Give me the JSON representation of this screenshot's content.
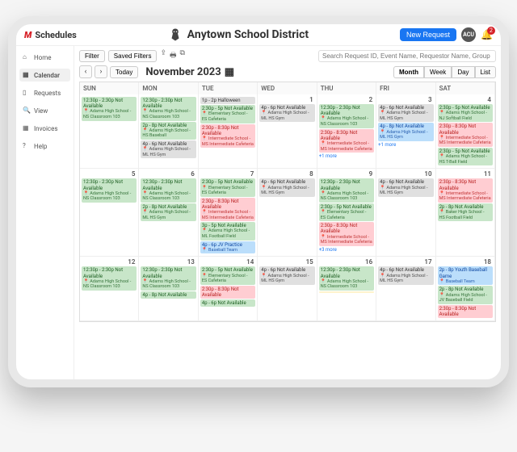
{
  "brand": {
    "prefix": "M",
    "name": "Schedules"
  },
  "district": "Anytown School District",
  "header_actions": {
    "new_request": "New Request",
    "avatar": "ACU",
    "notif_count": "2"
  },
  "sidebar": {
    "items": [
      {
        "icon": "home",
        "label": "Home"
      },
      {
        "icon": "calendar",
        "label": "Calendar"
      },
      {
        "icon": "doc",
        "label": "Requests"
      },
      {
        "icon": "view",
        "label": "View"
      },
      {
        "icon": "invoice",
        "label": "Invoices"
      },
      {
        "icon": "help",
        "label": "Help"
      }
    ]
  },
  "toolbar": {
    "filter": "Filter",
    "saved": "Saved Filters"
  },
  "search_placeholder": "Search Request ID, Event Name, Requestor Name, Group Name, Schedule ID",
  "nav": {
    "today": "Today",
    "month_label": "November 2023"
  },
  "views": [
    "Month",
    "Week",
    "Day",
    "List"
  ],
  "active_view": "Month",
  "day_headers": [
    "SUN",
    "MON",
    "TUE",
    "WED",
    "THU",
    "FRI",
    "SAT"
  ],
  "weeks": [
    [
      {
        "num": "",
        "events": [
          {
            "c": "green",
            "t": "12:30p - 2:30p Not Available",
            "l": "Adams High School - NS Classroom 103"
          }
        ]
      },
      {
        "num": "",
        "events": [
          {
            "c": "green",
            "t": "12:30p - 2:30p Not Available",
            "l": "Adams High School - NS Classroom 103"
          },
          {
            "c": "green",
            "t": "2p - 8p Not Available",
            "l": "Adams High School - HS Baseball"
          },
          {
            "c": "gray",
            "t": "4p - 6p Not Available",
            "l": "Adams High School - ML HS Gym"
          }
        ]
      },
      {
        "num": "",
        "events": [
          {
            "c": "gray",
            "t": "1p - 2p Halloween"
          },
          {
            "c": "green",
            "t": "2:30p - 5p Not Available",
            "l": "Elementary School - ES Cafeteria"
          },
          {
            "c": "red",
            "t": "2:30p - 8:30p Not Available",
            "l": "Intermediate School - MS Intermediate Cafeteria"
          }
        ]
      },
      {
        "num": "1",
        "events": [
          {
            "c": "gray",
            "t": "4p - 6p Not Available",
            "l": "Adams High School - ML HS Gym"
          }
        ]
      },
      {
        "num": "2",
        "events": [
          {
            "c": "green",
            "t": "12:30p - 2:30p Not Available",
            "l": "Adams High School - NS Classroom 103"
          },
          {
            "c": "red",
            "t": "2:30p - 8:30p Not Available",
            "l": "Intermediate School - MS Intermediate Cafeteria"
          }
        ],
        "more": "+1 more"
      },
      {
        "num": "3",
        "events": [
          {
            "c": "gray",
            "t": "4p - 6p Not Available",
            "l": "Adams High School - ML HS Gym"
          },
          {
            "c": "blue",
            "t": "4p - 8p Not Available",
            "l": "Adams High School - ML HS Gym"
          }
        ],
        "more": "+1 more"
      },
      {
        "num": "4",
        "events": [
          {
            "c": "green",
            "t": "2:30p - 5p Not Available",
            "l": "Adams High School - NJ Softball Field"
          },
          {
            "c": "red",
            "t": "2:30p - 8:30p Not Available",
            "l": "Intermediate School - MS Intermediate Cafeteria"
          },
          {
            "c": "green",
            "t": "2:30p - 5p Not Available",
            "l": "Adams High School - HS T-Ball Field"
          }
        ]
      }
    ],
    [
      {
        "num": "5",
        "events": [
          {
            "c": "green",
            "t": "12:30p - 2:30p Not Available",
            "l": "Adams High School - NS Classroom 103"
          }
        ]
      },
      {
        "num": "6",
        "events": [
          {
            "c": "green",
            "t": "12:30p - 2:30p Not Available",
            "l": "Adams High School - NS Classroom 103"
          },
          {
            "c": "green",
            "t": "2p - 8p Not Available",
            "l": "Adams High School - ML HS Gym"
          }
        ]
      },
      {
        "num": "7",
        "events": [
          {
            "c": "green",
            "t": "2:30p - 5p Not Available",
            "l": "Elementary School - ES Cafeteria"
          },
          {
            "c": "red",
            "t": "2:30p - 8:30p Not Available",
            "l": "Intermediate School - MS Intermediate Cafeteria"
          },
          {
            "c": "green",
            "t": "3p - 5p Not Available",
            "l": "Adams High School - ML Football Field"
          },
          {
            "c": "blue",
            "t": "4p - 6p JV Practice",
            "l": "Baseball Team"
          }
        ]
      },
      {
        "num": "8",
        "events": [
          {
            "c": "gray",
            "t": "4p - 6p Not Available",
            "l": "Adams High School - ML HS Gym"
          }
        ]
      },
      {
        "num": "9",
        "events": [
          {
            "c": "green",
            "t": "12:30p - 2:30p Not Available",
            "l": "Adams High School - NS Classroom 103"
          },
          {
            "c": "green",
            "t": "2:30p - 5p Not Available",
            "l": "Elementary School - ES Cafeteria"
          },
          {
            "c": "red",
            "t": "2:30p - 8:30p Not Available",
            "l": "Intermediate School - MS Intermediate Cafeteria"
          }
        ],
        "more": "+3 more"
      },
      {
        "num": "10",
        "events": [
          {
            "c": "gray",
            "t": "4p - 6p Not Available",
            "l": "Adams High School - ML HS Gym"
          }
        ]
      },
      {
        "num": "11",
        "events": [
          {
            "c": "red",
            "t": "2:30p - 8:30p Not Available",
            "l": "Intermediate School - MS Intermediate Cafeteria"
          },
          {
            "c": "green",
            "t": "2p - 8p Not Available",
            "l": "Baker High School - HS Football Field"
          }
        ]
      }
    ],
    [
      {
        "num": "12",
        "events": [
          {
            "c": "green",
            "t": "12:30p - 2:30p Not Available",
            "l": "Adams High School - NS Classroom 103"
          }
        ]
      },
      {
        "num": "13",
        "events": [
          {
            "c": "green",
            "t": "12:30p - 2:30p Not Available",
            "l": "Adams High School - NS Classroom 103"
          },
          {
            "c": "green",
            "t": "4p - 8p Not Available"
          }
        ]
      },
      {
        "num": "14",
        "events": [
          {
            "c": "green",
            "t": "2:30p - 5p Not Available",
            "l": "Elementary School - ES Cafeteria"
          },
          {
            "c": "red",
            "t": "2:30p - 8:30p Not Available"
          },
          {
            "c": "green",
            "t": "4p - 6p Not Available"
          }
        ]
      },
      {
        "num": "15",
        "events": [
          {
            "c": "gray",
            "t": "4p - 6p Not Available",
            "l": "Adams High School - ML HS Gym"
          }
        ]
      },
      {
        "num": "16",
        "events": [
          {
            "c": "green",
            "t": "12:30p - 2:30p Not Available",
            "l": "Adams High School - NS Classroom 103"
          },
          {
            "c": "yellow",
            "t": ""
          }
        ]
      },
      {
        "num": "17",
        "events": [
          {
            "c": "gray",
            "t": "4p - 6p Not Available",
            "l": "Adams High School - ML HS Gym"
          }
        ]
      },
      {
        "num": "18",
        "events": [
          {
            "c": "blue",
            "t": "2p - 8p Youth Baseball Game",
            "l": "Baseball Team"
          },
          {
            "c": "green",
            "t": "2p - 8p Not Available",
            "l": "Adams High School - JV Baseball Field"
          },
          {
            "c": "red",
            "t": "2:30p - 8:30p Not Available"
          }
        ]
      }
    ]
  ]
}
